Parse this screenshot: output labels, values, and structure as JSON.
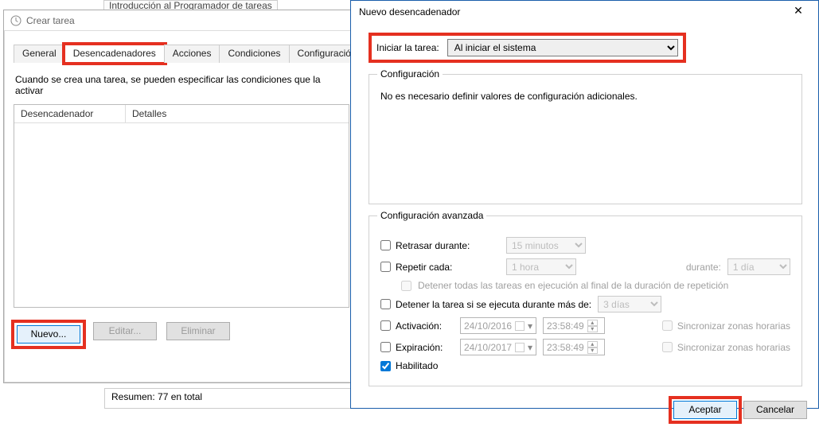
{
  "lib_window_title": "Introducción al Programador de tareas",
  "create": {
    "title": "Crear tarea",
    "tabs": [
      "General",
      "Desencadenadores",
      "Acciones",
      "Condiciones",
      "Configuración"
    ],
    "active_tab": 1,
    "desc": "Cuando se crea una tarea, se pueden especificar las condiciones que la activar",
    "cols": [
      "Desencadenador",
      "Detalles"
    ],
    "btn_new": "Nuevo...",
    "btn_edit": "Editar...",
    "btn_del": "Eliminar"
  },
  "summary": "Resumen: 77 en total",
  "trigger": {
    "title": "Nuevo desencadenador",
    "start_label": "Iniciar la tarea:",
    "start_value": "Al iniciar el sistema",
    "config_legend": "Configuración",
    "config_text": "No es necesario definir valores de configuración adicionales.",
    "adv_legend": "Configuración avanzada",
    "delay_label": "Retrasar durante:",
    "delay_value": "15 minutos",
    "repeat_label": "Repetir cada:",
    "repeat_value": "1 hora",
    "duration_label": "durante:",
    "duration_value": "1 día",
    "stop_all": "Detener todas las tareas en ejecución al final de la duración de repetición",
    "stop_if_label": "Detener la tarea si se ejecuta durante más de:",
    "stop_if_value": "3 días",
    "activation_label": "Activación:",
    "activation_date": "24/10/2016",
    "activation_time": "23:58:49",
    "expiration_label": "Expiración:",
    "expiration_date": "24/10/2017",
    "expiration_time": "23:58:49",
    "sync_label": "Sincronizar zonas horarias",
    "enabled_label": "Habilitado",
    "ok": "Aceptar",
    "cancel": "Cancelar"
  }
}
